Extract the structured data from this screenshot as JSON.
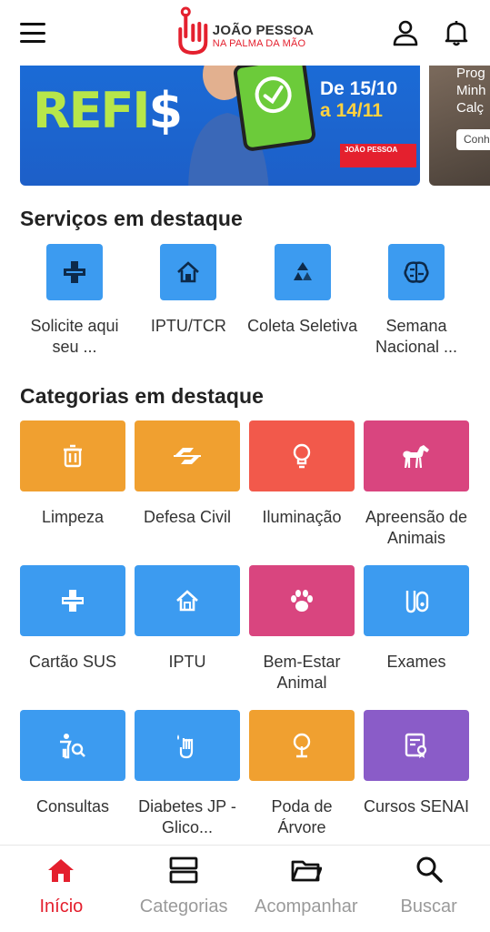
{
  "header": {
    "logo_title": "JOÃO PESSOA",
    "logo_subtitle": "NA PALMA DA MÃO",
    "brand_color": "#e4202e"
  },
  "banner": {
    "headline_part1": "REFI",
    "headline_part2": "$",
    "date_line1": "De 15/10",
    "date_line2": "a 14/11",
    "badge_title": "JOÃO PESSOA",
    "side_text_1": "Prog",
    "side_text_2": "Minh",
    "side_text_3": "Calç",
    "side_cta": "Conh"
  },
  "services_section": {
    "title": "Serviços em destaque",
    "items": [
      {
        "label": "Solicite aqui seu ...",
        "icon": "cross-icon"
      },
      {
        "label": "IPTU/TCR",
        "icon": "house-icon"
      },
      {
        "label": "Coleta Seletiva",
        "icon": "recycle-icon"
      },
      {
        "label": "Semana Nacional ...",
        "icon": "brain-icon"
      }
    ],
    "accent": "#3c9bf0"
  },
  "categories_section": {
    "title": "Categorias em destaque",
    "items": [
      {
        "label": "Limpeza",
        "icon": "trash-icon",
        "color": "#f0a030"
      },
      {
        "label": "Defesa Civil",
        "icon": "shield-arrows-icon",
        "color": "#f0a030"
      },
      {
        "label": "Iluminação",
        "icon": "lightbulb-icon",
        "color": "#f2594b"
      },
      {
        "label": "Apreensão de Animais",
        "icon": "horse-icon",
        "color": "#d9457f"
      },
      {
        "label": "Cartão SUS",
        "icon": "cross-icon",
        "color": "#3c9bf0"
      },
      {
        "label": "IPTU",
        "icon": "house-icon",
        "color": "#3c9bf0"
      },
      {
        "label": "Bem-Estar Animal",
        "icon": "paw-icon",
        "color": "#d9457f"
      },
      {
        "label": "Exames",
        "icon": "test-tube-icon",
        "color": "#3c9bf0"
      },
      {
        "label": "Consultas",
        "icon": "doctor-search-icon",
        "color": "#3c9bf0"
      },
      {
        "label": "Diabetes JP - Glico...",
        "icon": "finger-drop-icon",
        "color": "#3c9bf0"
      },
      {
        "label": "Poda de Árvore",
        "icon": "tree-icon",
        "color": "#f0a030"
      },
      {
        "label": "Cursos SENAI",
        "icon": "certificate-icon",
        "color": "#8a5cc8"
      }
    ]
  },
  "bottom_nav": {
    "items": [
      {
        "label": "Início",
        "icon": "home-icon",
        "active": true
      },
      {
        "label": "Categorias",
        "icon": "categories-icon",
        "active": false
      },
      {
        "label": "Acompanhar",
        "icon": "folder-icon",
        "active": false
      },
      {
        "label": "Buscar",
        "icon": "search-icon",
        "active": false
      }
    ]
  }
}
